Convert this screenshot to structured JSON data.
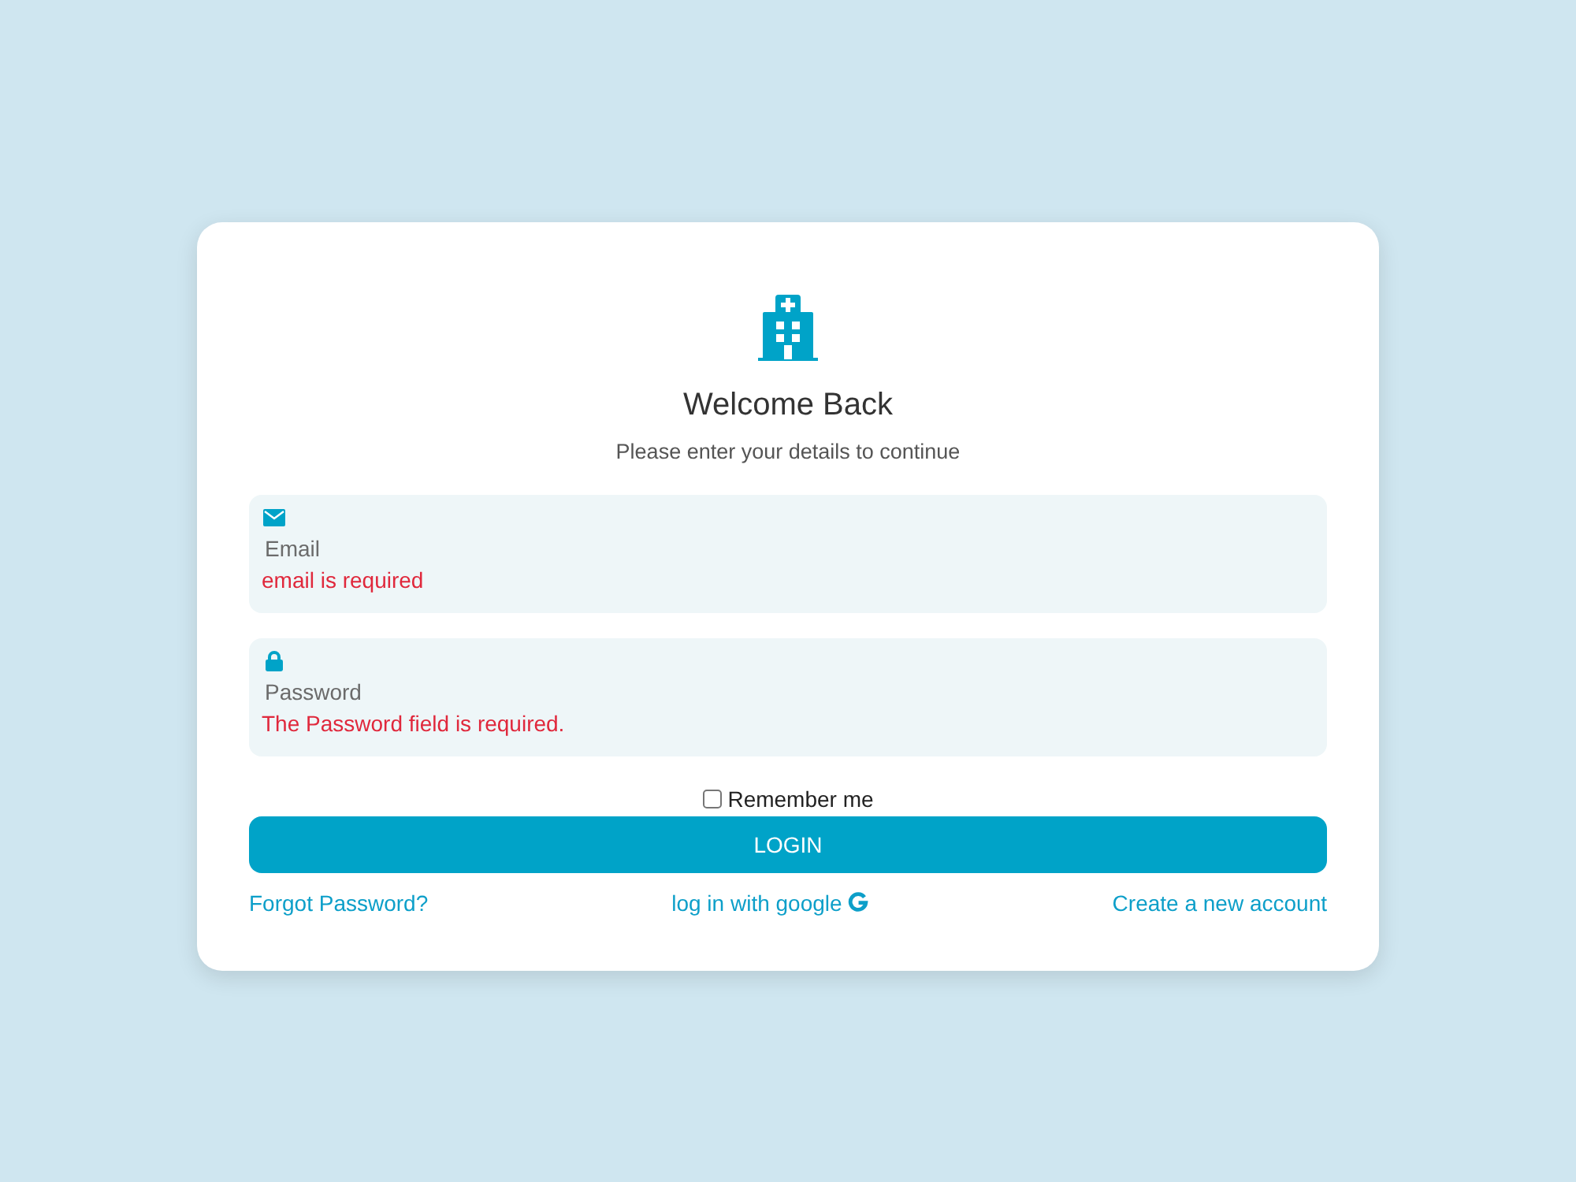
{
  "header": {
    "title": "Welcome Back",
    "subtitle": "Please enter your details to continue"
  },
  "fields": [
    {
      "kind": "email",
      "placeholder": "Email",
      "error": "email is required"
    },
    {
      "kind": "password",
      "placeholder": "Password",
      "error": "The Password field is required."
    }
  ],
  "remember": {
    "label": "Remember me",
    "checked": false
  },
  "login_button": {
    "label": "LOGIN"
  },
  "links": [
    {
      "kind": "forgot",
      "label": "Forgot Password?"
    },
    {
      "kind": "google",
      "label": "log in with google"
    },
    {
      "kind": "create",
      "label": "Create a new account"
    }
  ]
}
